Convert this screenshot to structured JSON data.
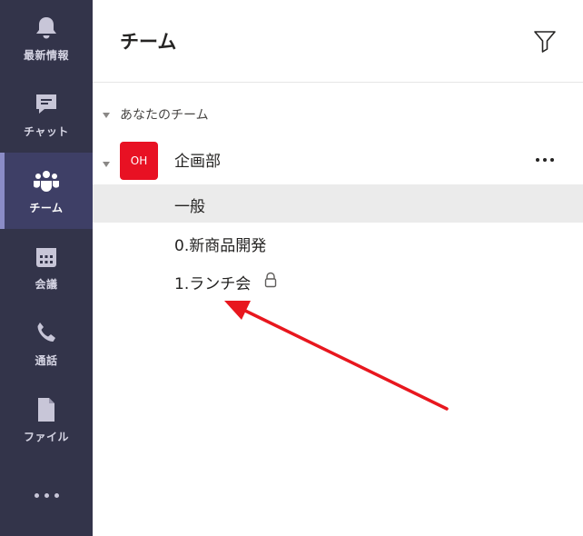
{
  "rail": {
    "items": [
      {
        "label": "最新情報",
        "icon": "bell-icon",
        "active": false
      },
      {
        "label": "チャット",
        "icon": "chat-icon",
        "active": false
      },
      {
        "label": "チーム",
        "icon": "teams-icon",
        "active": true
      },
      {
        "label": "会議",
        "icon": "calendar-icon",
        "active": false
      },
      {
        "label": "通話",
        "icon": "phone-icon",
        "active": false
      },
      {
        "label": "ファイル",
        "icon": "file-icon",
        "active": false
      }
    ],
    "more_icon": "more-horizontal-icon"
  },
  "header": {
    "title": "チーム",
    "filter_icon": "filter-icon"
  },
  "section": {
    "label": "あなたのチーム"
  },
  "team": {
    "avatar_initials": "OH",
    "avatar_color": "#e81123",
    "name": "企画部",
    "more_icon": "more-horizontal-icon"
  },
  "channels": [
    {
      "name": "一般",
      "selected": true,
      "locked": false
    },
    {
      "name": "0.新商品開発",
      "selected": false,
      "locked": false
    },
    {
      "name": "1.ランチ会",
      "selected": false,
      "locked": true
    }
  ],
  "colors": {
    "rail_bg": "#33344a",
    "rail_active": "#3e3f66",
    "accent_red": "#e81123",
    "arrow": "#e8171e",
    "selected_bg": "#ebebeb"
  }
}
